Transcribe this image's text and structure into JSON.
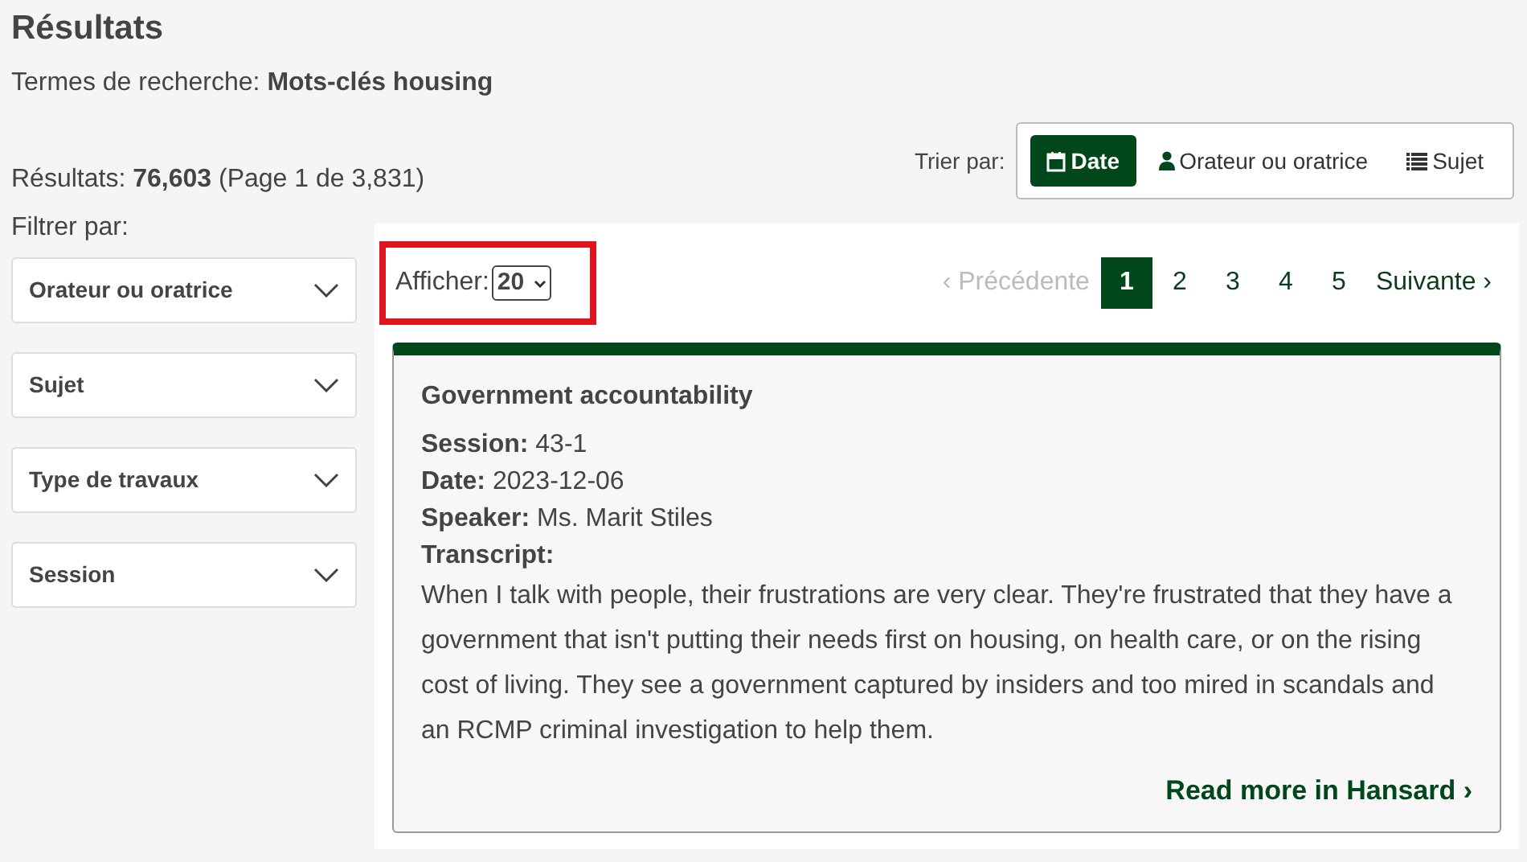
{
  "title": "Résultats",
  "search_terms": {
    "label": "Termes de recherche:",
    "value": "Mots-clés housing"
  },
  "results": {
    "label": "Résultats:",
    "count": "76,603",
    "page": "(Page 1 de 3,831)"
  },
  "sort": {
    "label": "Trier par:",
    "options": [
      {
        "label": "Date",
        "kind": "calendar",
        "selected": true
      },
      {
        "label": "Orateur ou oratrice",
        "kind": "user",
        "selected": false
      },
      {
        "label": "Sujet",
        "kind": "list",
        "selected": false
      }
    ]
  },
  "filter": {
    "label": "Filtrer par:",
    "items": [
      {
        "label": "Orateur ou oratrice",
        "expanded": false
      },
      {
        "label": "Sujet",
        "expanded": false
      },
      {
        "label": "Type de travaux",
        "expanded": false
      },
      {
        "label": "Session",
        "expanded": false
      }
    ]
  },
  "show": {
    "label": "Afficher:",
    "value": "20",
    "highlighted": true
  },
  "pagination": {
    "previous": {
      "label": "‹ Précédente",
      "disabled": true
    },
    "pages": [
      {
        "label": "1",
        "selected": true
      },
      {
        "label": "2",
        "selected": false
      },
      {
        "label": "3",
        "selected": false
      },
      {
        "label": "4",
        "selected": false
      },
      {
        "label": "5",
        "selected": false
      }
    ],
    "next": {
      "label": "Suivante ›",
      "disabled": false
    }
  },
  "result_cards": [
    {
      "title": "Government accountability",
      "fields": [
        {
          "label": "Session:",
          "value": "43-1"
        },
        {
          "label": "Date:",
          "value": "2023-12-06"
        },
        {
          "label": "Speaker:",
          "value": "Ms. Marit Stiles"
        }
      ],
      "transcript_label": "Transcript:",
      "transcript": "When I talk with people, their frustrations are very clear. They're frustrated that they have a government that isn't putting their needs first on housing, on health care, or on the rising cost of living. They see a government captured by insiders and too mired in scandals and an RCMP criminal investigation to help them.",
      "link": "Read more in Hansard ›"
    }
  ]
}
